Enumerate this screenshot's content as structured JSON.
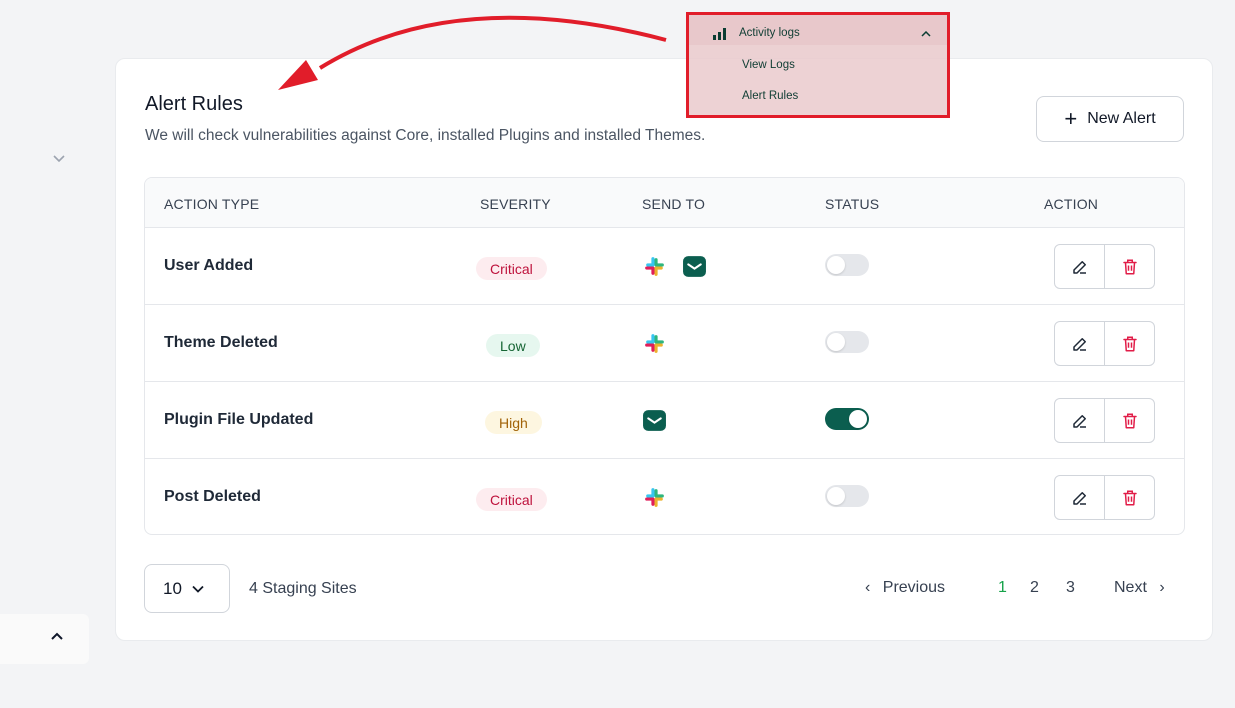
{
  "page": {
    "title": "Alert Rules",
    "subtitle": "We will check vulnerabilities against Core, installed Plugins and installed Themes.",
    "new_alert_label": "New Alert"
  },
  "table": {
    "columns": [
      "ACTION TYPE",
      "SEVERITY",
      "SEND TO",
      "STATUS",
      "ACTION"
    ],
    "rows": [
      {
        "action_type": "User Added",
        "severity": "Critical",
        "send_to": [
          "slack-icon",
          "email-icon"
        ],
        "status_on": false
      },
      {
        "action_type": "Theme Deleted",
        "severity": "Low",
        "send_to": [
          "slack-icon"
        ],
        "status_on": false
      },
      {
        "action_type": "Plugin File Updated",
        "severity": "High",
        "send_to": [
          "email-icon"
        ],
        "status_on": true
      },
      {
        "action_type": "Post Deleted",
        "severity": "Critical",
        "send_to": [
          "slack-icon"
        ],
        "status_on": false
      }
    ]
  },
  "footer": {
    "per_page": "10",
    "sites_label": "4 Staging Sites",
    "previous_label": "Previous",
    "next_label": "Next",
    "pages": [
      "1",
      "2",
      "3"
    ],
    "current_page": "1"
  },
  "menu_overlay": {
    "section_label": "Activity logs",
    "items": [
      "View Logs",
      "Alert Rules"
    ]
  },
  "colors": {
    "accent": "#0b5e4f",
    "critical": "#be123c",
    "low": "#166534",
    "high": "#a16207",
    "annotation": "#e11d2a",
    "active_page": "#16a34a"
  }
}
